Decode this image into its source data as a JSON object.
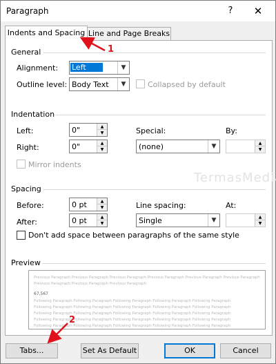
{
  "window": {
    "title": "Paragraph",
    "help_label": "?",
    "close_label": "✕"
  },
  "tabs": [
    {
      "label": "Indents and Spacing",
      "active": true
    },
    {
      "label": "Line and Page Breaks",
      "active": false
    }
  ],
  "general": {
    "heading": "General",
    "alignment_label": "Alignment:",
    "alignment_value": "Left",
    "outline_label": "Outline level:",
    "outline_value": "Body Text",
    "collapsed_label": "Collapsed by default"
  },
  "indentation": {
    "heading": "Indentation",
    "left_label": "Left:",
    "left_value": "0\"",
    "right_label": "Right:",
    "right_value": "0\"",
    "special_label": "Special:",
    "special_value": "(none)",
    "by_label": "By:",
    "by_value": "",
    "mirror_label": "Mirror indents"
  },
  "spacing": {
    "heading": "Spacing",
    "before_label": "Before:",
    "before_value": "0 pt",
    "after_label": "After:",
    "after_value": "0 pt",
    "line_spacing_label": "Line spacing:",
    "line_spacing_value": "Single",
    "at_label": "At:",
    "at_value": "",
    "dont_add_label": "Don't add space between paragraphs of the same style"
  },
  "preview": {
    "heading": "Preview",
    "prev_line_1": "Previous Paragraph Previous Paragraph Previous Paragraph Previous Paragraph Previous Paragraph Previous Paragraph",
    "prev_line_2": "Previous Paragraph Previous Paragraph Previous Paragraph",
    "current_text": "67,567",
    "follow_line": "Following Paragraph Following Paragraph Following Paragraph Following Paragraph Following Paragraph"
  },
  "buttons": {
    "tabs": "Tabs...",
    "set_default": "Set As Default",
    "ok": "OK",
    "cancel": "Cancel"
  },
  "annotations": {
    "marker_1": "1",
    "marker_2": "2",
    "color": "#e0111b"
  },
  "watermark": "TermasMedia",
  "colors": {
    "accent": "#0078d7",
    "panel": "#ffffff",
    "dialog_bg": "#f0f0f0"
  }
}
